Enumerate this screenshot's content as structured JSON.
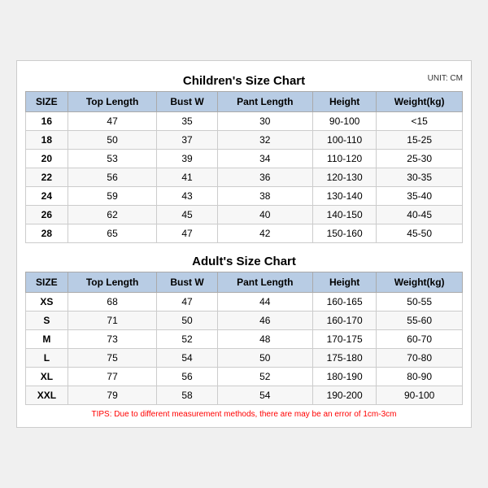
{
  "children_chart": {
    "title": "Children's Size Chart",
    "unit": "UNIT: CM",
    "columns": [
      "SIZE",
      "Top Length",
      "Bust W",
      "Pant Length",
      "Height",
      "Weight(kg)"
    ],
    "rows": [
      [
        "16",
        "47",
        "35",
        "30",
        "90-100",
        "<15"
      ],
      [
        "18",
        "50",
        "37",
        "32",
        "100-110",
        "15-25"
      ],
      [
        "20",
        "53",
        "39",
        "34",
        "110-120",
        "25-30"
      ],
      [
        "22",
        "56",
        "41",
        "36",
        "120-130",
        "30-35"
      ],
      [
        "24",
        "59",
        "43",
        "38",
        "130-140",
        "35-40"
      ],
      [
        "26",
        "62",
        "45",
        "40",
        "140-150",
        "40-45"
      ],
      [
        "28",
        "65",
        "47",
        "42",
        "150-160",
        "45-50"
      ]
    ]
  },
  "adult_chart": {
    "title": "Adult's Size Chart",
    "columns": [
      "SIZE",
      "Top Length",
      "Bust W",
      "Pant Length",
      "Height",
      "Weight(kg)"
    ],
    "rows": [
      [
        "XS",
        "68",
        "47",
        "44",
        "160-165",
        "50-55"
      ],
      [
        "S",
        "71",
        "50",
        "46",
        "160-170",
        "55-60"
      ],
      [
        "M",
        "73",
        "52",
        "48",
        "170-175",
        "60-70"
      ],
      [
        "L",
        "75",
        "54",
        "50",
        "175-180",
        "70-80"
      ],
      [
        "XL",
        "77",
        "56",
        "52",
        "180-190",
        "80-90"
      ],
      [
        "XXL",
        "79",
        "58",
        "54",
        "190-200",
        "90-100"
      ]
    ]
  },
  "tips": "TIPS: Due to different measurement methods, there are may be an error of 1cm-3cm"
}
